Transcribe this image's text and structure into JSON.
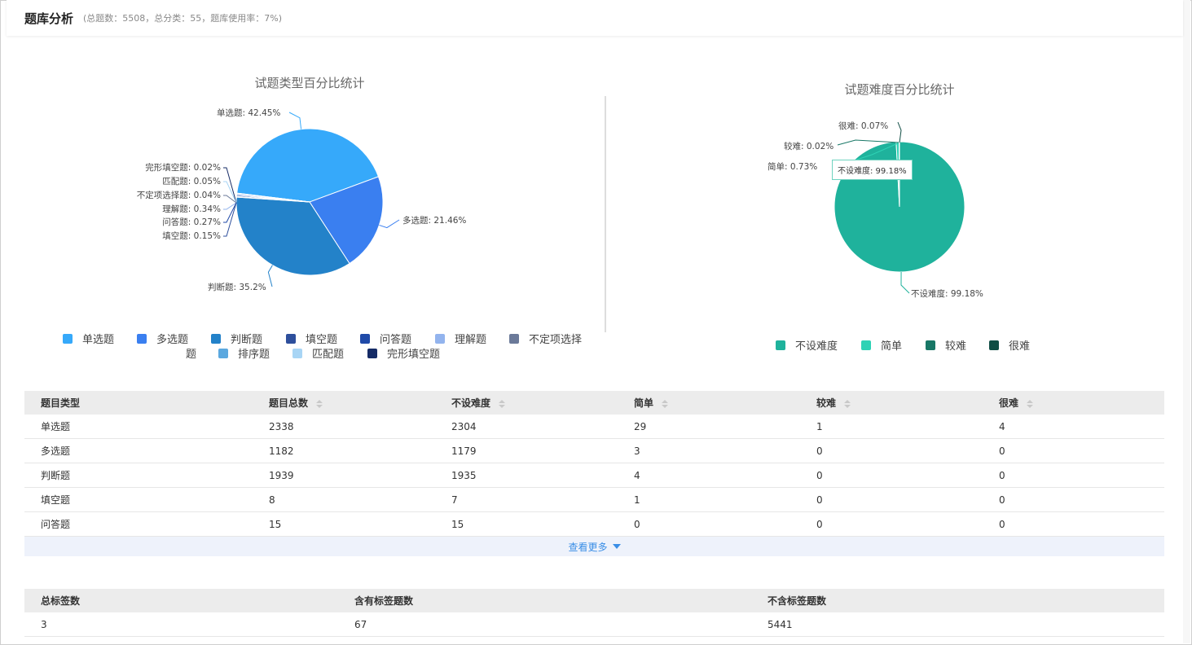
{
  "header": {
    "title": "题库分析",
    "stats": "(总题数：5508，总分类：55，题库使用率：7%)"
  },
  "chart_data": [
    {
      "type": "pie",
      "title": "试题类型百分比统计",
      "series": [
        {
          "name": "单选题",
          "value": 42.45,
          "color": "#36a9fa"
        },
        {
          "name": "多选题",
          "value": 21.46,
          "color": "#3a7ff0"
        },
        {
          "name": "判断题",
          "value": 35.2,
          "color": "#2382c9"
        },
        {
          "name": "填空题",
          "value": 0.15,
          "color": "#2e4f9c"
        },
        {
          "name": "问答题",
          "value": 0.27,
          "color": "#1f4aa8"
        },
        {
          "name": "理解题",
          "value": 0.34,
          "color": "#93b4ee"
        },
        {
          "name": "不定项选择题",
          "value": 0.04,
          "color": "#6b7a99"
        },
        {
          "name": "排序题",
          "value": 0.0,
          "color": "#5ba8df"
        },
        {
          "name": "匹配题",
          "value": 0.05,
          "color": "#a8d5f5"
        },
        {
          "name": "完形填空题",
          "value": 0.02,
          "color": "#152b66"
        }
      ],
      "labels": [
        "单选题: 42.45%",
        "多选题: 21.46%",
        "判断题: 35.2%",
        "填空题: 0.15%",
        "问答题: 0.27%",
        "理解题: 0.34%",
        "不定项选择题: 0.04%",
        "匹配题: 0.05%",
        "完形填空题: 0.02%"
      ],
      "legend_position": "bottom"
    },
    {
      "type": "pie",
      "title": "试题难度百分比统计",
      "series": [
        {
          "name": "不设难度",
          "value": 99.18,
          "color": "#1fb29c"
        },
        {
          "name": "简单",
          "value": 0.73,
          "color": "#2ed2b5"
        },
        {
          "name": "较难",
          "value": 0.02,
          "color": "#187766"
        },
        {
          "name": "很难",
          "value": 0.07,
          "color": "#0f4d44"
        }
      ],
      "labels": [
        "不设难度: 99.18%",
        "简单: 0.73%",
        "较难: 0.02%",
        "很难: 0.07%"
      ],
      "tooltip": "不设难度: 99.18%",
      "legend_position": "bottom"
    }
  ],
  "legend1": [
    "单选题",
    "多选题",
    "判断题",
    "填空题",
    "问答题",
    "理解题",
    "不定项选择",
    "题",
    "排序题",
    "匹配题",
    "完形填空题"
  ],
  "legend2": [
    "不设难度",
    "简单",
    "较难",
    "很难"
  ],
  "table": {
    "headers": [
      "题目类型",
      "题目总数",
      "不设难度",
      "简单",
      "较难",
      "很难"
    ],
    "rows": [
      [
        "单选题",
        "2338",
        "2304",
        "29",
        "1",
        "4"
      ],
      [
        "多选题",
        "1182",
        "1179",
        "3",
        "0",
        "0"
      ],
      [
        "判断题",
        "1939",
        "1935",
        "4",
        "0",
        "0"
      ],
      [
        "填空题",
        "8",
        "7",
        "1",
        "0",
        "0"
      ],
      [
        "问答题",
        "15",
        "15",
        "0",
        "0",
        "0"
      ]
    ],
    "more_label": "查看更多"
  },
  "tags_table": {
    "headers": [
      "总标签数",
      "含有标签题数",
      "不含标签题数"
    ],
    "values": [
      "3",
      "67",
      "5441"
    ]
  }
}
